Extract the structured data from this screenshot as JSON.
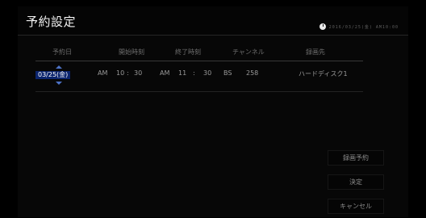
{
  "header": {
    "title": "予約設定",
    "datetime": "2016/03/25(金) AM10:00"
  },
  "table": {
    "columns": [
      "予約日",
      "開始時刻",
      "終了時刻",
      "チャンネル",
      "録画先"
    ],
    "values": {
      "date": "03/25(金)",
      "start_ampm": "AM",
      "start_hour": "10",
      "start_sep": ":",
      "start_min": "30",
      "end_ampm": "AM",
      "end_hour": "11",
      "end_sep": ":",
      "end_min": "30",
      "channel_type": "BS",
      "channel_number": "258",
      "destination": "ハードディスク1"
    }
  },
  "buttons": {
    "record": "録画予約",
    "confirm": "決定",
    "cancel": "キャンセル"
  },
  "icons": {
    "clock": "clock-icon",
    "up": "arrow-up-icon",
    "down": "arrow-down-icon"
  },
  "colors": {
    "selection": "#0b246d",
    "arrow": "#4d73c7"
  }
}
